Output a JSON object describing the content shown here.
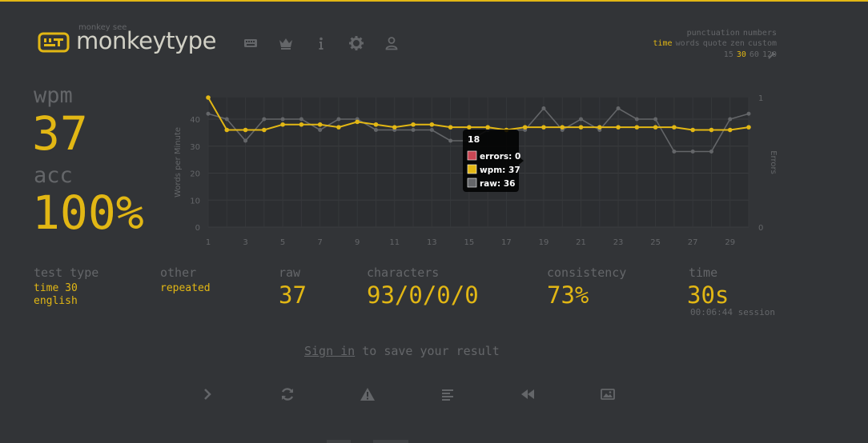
{
  "header": {
    "logo_subtitle": "monkey see",
    "logo_title": "monkeytype",
    "nav_icons": [
      "keyboard-icon",
      "crown-icon",
      "info-icon",
      "gear-icon",
      "user-icon"
    ]
  },
  "config": {
    "row1": [
      "punctuation",
      "numbers"
    ],
    "row2": [
      "time",
      "words",
      "quote",
      "zen",
      "custom"
    ],
    "row2_active": "time",
    "row3": [
      "15",
      "30",
      "60",
      "120"
    ],
    "row3_active": "30"
  },
  "result": {
    "wpm_label": "wpm",
    "wpm_value": "37",
    "acc_label": "acc",
    "acc_value": "100%"
  },
  "stats": {
    "test_type_label": "test type",
    "test_type_line1": "time 30",
    "test_type_line2": "english",
    "other_label": "other",
    "other_value": "repeated",
    "raw_label": "raw",
    "raw_value": "37",
    "characters_label": "characters",
    "characters_value": "93/0/0/0",
    "consistency_label": "consistency",
    "consistency_value": "73%",
    "time_label": "time",
    "time_value": "30s",
    "session_value": "00:06:44 session"
  },
  "signin": {
    "link": "Sign in",
    "rest": " to save your result"
  },
  "actions": [
    "next-test",
    "restart",
    "report",
    "words-history",
    "replay",
    "save-screenshot"
  ],
  "colors": {
    "bg": "#323437",
    "accent": "#e2b714",
    "sub": "#646669",
    "text": "#d1d0c5",
    "error": "#ca4754"
  },
  "chart_data": {
    "type": "line",
    "x": [
      1,
      2,
      3,
      4,
      5,
      6,
      7,
      8,
      9,
      10,
      11,
      12,
      13,
      14,
      15,
      16,
      17,
      18,
      19,
      20,
      21,
      22,
      23,
      24,
      25,
      26,
      27,
      28,
      29,
      30
    ],
    "xticks": [
      1,
      3,
      5,
      7,
      9,
      11,
      13,
      15,
      17,
      19,
      21,
      23,
      25,
      27,
      29
    ],
    "ylabel": "Words per Minute",
    "ylabel_right": "Errors",
    "ylim": [
      0,
      48
    ],
    "yticks": [
      0,
      10,
      20,
      30,
      40
    ],
    "ylim_right": [
      0,
      1
    ],
    "yticks_right": [
      0,
      1
    ],
    "grid": true,
    "series": [
      {
        "name": "wpm",
        "color": "#e2b714",
        "values": [
          48,
          36,
          36,
          36,
          38,
          38,
          38,
          37,
          39,
          38,
          37,
          38,
          38,
          37,
          37,
          37,
          36,
          37,
          37,
          37,
          37,
          37,
          37,
          37,
          37,
          37,
          36,
          36,
          36,
          37
        ]
      },
      {
        "name": "raw",
        "color": "#646669",
        "values": [
          42,
          40,
          32,
          40,
          40,
          40,
          36,
          40,
          40,
          36,
          36,
          36,
          36,
          32,
          32,
          36,
          36,
          36,
          44,
          36,
          40,
          36,
          44,
          40,
          40,
          28,
          28,
          28,
          40,
          42
        ]
      },
      {
        "name": "errors",
        "color": "#ca4754",
        "values": [
          0,
          0,
          0,
          0,
          0,
          0,
          0,
          0,
          0,
          0,
          0,
          0,
          0,
          0,
          0,
          0,
          0,
          0,
          0,
          0,
          0,
          0,
          0,
          0,
          0,
          0,
          0,
          0,
          0,
          0
        ]
      }
    ],
    "tooltip": {
      "title": "18",
      "lines": [
        "errors: 0",
        "wpm: 37",
        "raw: 36"
      ]
    }
  }
}
